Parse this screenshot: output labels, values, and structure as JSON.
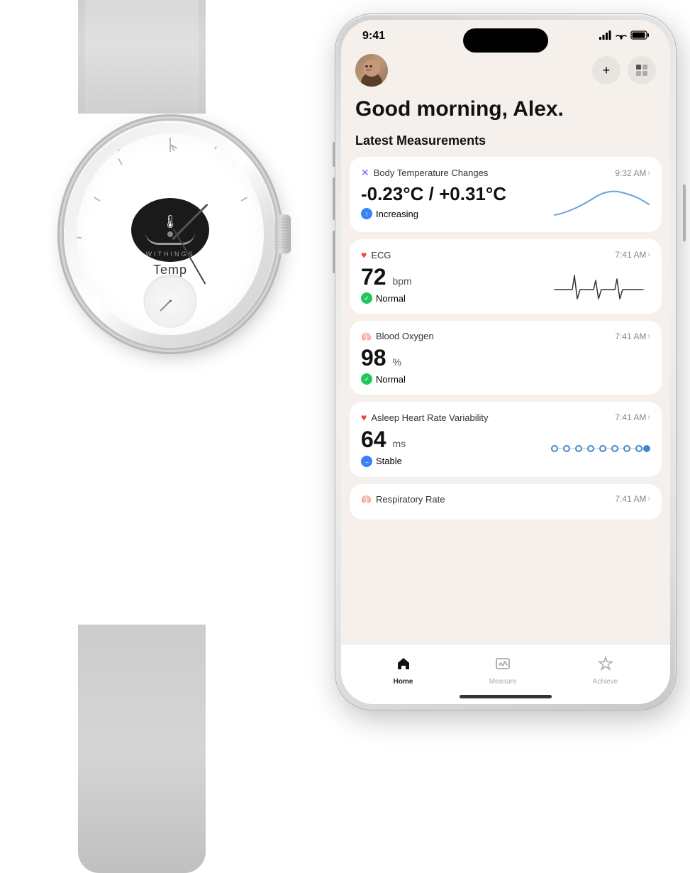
{
  "watch": {
    "brand": "WITHINGS",
    "temp_label": "Temp"
  },
  "phone": {
    "status_bar": {
      "time": "9:41",
      "signal_icon": "signal-icon",
      "wifi_icon": "wifi-icon",
      "battery_icon": "battery-icon"
    },
    "header": {
      "avatar_alt": "user avatar",
      "add_button_label": "+",
      "settings_button_label": "⊙"
    },
    "greeting": "Good morning, Alex.",
    "section_title": "Latest Measurements",
    "measurements": [
      {
        "id": "body-temp",
        "icon_type": "temp",
        "title": "Body Temperature Changes",
        "time": "9:32 AM",
        "value": "-0.23°C / +0.31°C",
        "status": "Increasing",
        "status_type": "blue",
        "chart_type": "temp-line"
      },
      {
        "id": "ecg",
        "icon_type": "ecg",
        "title": "ECG",
        "time": "7:41 AM",
        "value": "72",
        "unit": "bpm",
        "status": "Normal",
        "status_type": "green",
        "chart_type": "ecg-line"
      },
      {
        "id": "blood-oxygen",
        "icon_type": "oxygen",
        "title": "Blood Oxygen",
        "time": "7:41 AM",
        "value": "98",
        "unit": "%",
        "status": "Normal",
        "status_type": "green",
        "chart_type": "none"
      },
      {
        "id": "hrv",
        "icon_type": "hrv",
        "title": "Asleep Heart Rate Variability",
        "time": "7:41 AM",
        "value": "64",
        "unit": "ms",
        "status": "Stable",
        "status_type": "blue",
        "chart_type": "hrv-dots"
      },
      {
        "id": "resp",
        "icon_type": "resp",
        "title": "Respiratory Rate",
        "time": "7:41 AM",
        "value": "",
        "unit": "",
        "status": "",
        "status_type": "",
        "chart_type": "none"
      }
    ],
    "nav": {
      "items": [
        {
          "id": "home",
          "label": "Home",
          "icon": "home-icon",
          "active": true
        },
        {
          "id": "measure",
          "label": "Measure",
          "icon": "measure-icon",
          "active": false
        },
        {
          "id": "achieve",
          "label": "Achieve",
          "icon": "achieve-icon",
          "active": false
        }
      ]
    }
  }
}
